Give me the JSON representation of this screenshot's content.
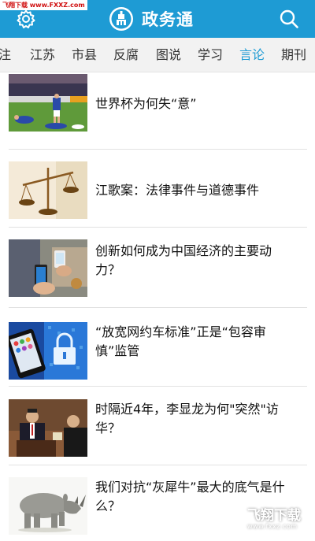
{
  "watermark_top": "飞翔下载 www.FXXZ.com",
  "header": {
    "title": "政务通",
    "background": "#1e9bd4"
  },
  "tabs": [
    {
      "label": "注"
    },
    {
      "label": "江苏"
    },
    {
      "label": "市县"
    },
    {
      "label": "反腐"
    },
    {
      "label": "图说"
    },
    {
      "label": "学习"
    },
    {
      "label": "言论",
      "active": true
    },
    {
      "label": "期刊"
    }
  ],
  "articles": [
    {
      "title": "世界杯为何失“意”",
      "thumb": "soccer-players-image"
    },
    {
      "title": "江歌案：法律事件与道德事件",
      "thumb": "justice-scales-image"
    },
    {
      "title": "创新如何成为中国经济的主要动力？",
      "thumb": "mobile-payment-image"
    },
    {
      "title": "“放宽网约车标准”正是“包容审慎”监管",
      "thumb": "smartphone-lock-image"
    },
    {
      "title": "时隔近4年，李显龙为何\"突然\"访华？",
      "thumb": "speaker-podium-image"
    },
    {
      "title": "我们对抗“灰犀牛”最大的底气是什么？",
      "thumb": "rhinoceros-image"
    }
  ],
  "watermark_br": {
    "text": "飞翔下载",
    "sub": "www.fxxz.com"
  }
}
